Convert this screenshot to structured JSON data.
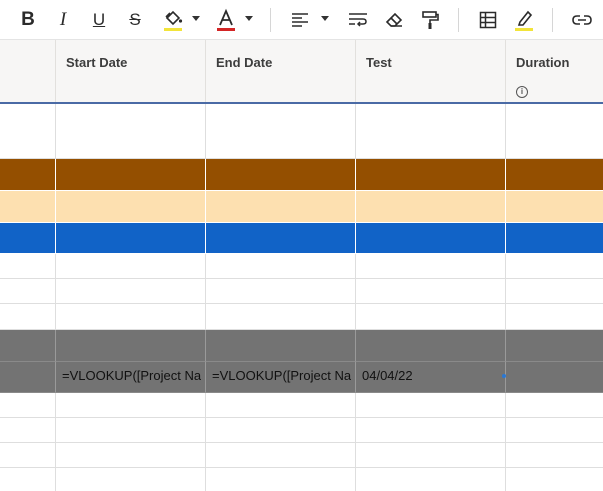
{
  "toolbar": {
    "items": [
      {
        "name": "bold-button",
        "glyph": "B"
      },
      {
        "name": "italic-button",
        "glyph": "I"
      },
      {
        "name": "underline-button",
        "glyph": "U"
      },
      {
        "name": "strikethrough-button",
        "glyph": "S"
      },
      {
        "name": "fill-color-button",
        "swatch": "#f2e43a"
      },
      {
        "name": "text-color-button",
        "glyph": "A",
        "swatch": "#d32525"
      },
      {
        "name": "align-button"
      },
      {
        "name": "wrap-text-button"
      },
      {
        "name": "clear-format-button"
      },
      {
        "name": "format-painter-button"
      },
      {
        "name": "table-button"
      },
      {
        "name": "highlight-button",
        "swatch": "#f2e43a"
      },
      {
        "name": "link-button"
      }
    ]
  },
  "columns": [
    {
      "label": ""
    },
    {
      "label": "Start Date"
    },
    {
      "label": "End Date"
    },
    {
      "label": "Test"
    },
    {
      "label": "Duration",
      "info_icon": "info-icon"
    }
  ],
  "rows": [
    {
      "style": "white",
      "fill": "#ffffff",
      "cells": [
        "",
        "",
        "",
        "",
        ""
      ]
    },
    {
      "style": "dark",
      "fill": "#944f00",
      "cells": [
        "",
        "",
        "",
        "",
        ""
      ]
    },
    {
      "style": "light",
      "fill": "#fde0b0",
      "cells": [
        "",
        "",
        "",
        "",
        ""
      ]
    },
    {
      "style": "dark",
      "fill": "#1163c7",
      "cells": [
        "",
        "",
        "",
        "",
        ""
      ]
    },
    {
      "style": "white",
      "fill": "#ffffff",
      "cells": [
        "",
        "",
        "",
        "",
        ""
      ]
    },
    {
      "style": "white",
      "fill": "#ffffff",
      "cells": [
        "",
        "",
        "",
        "",
        ""
      ]
    },
    {
      "style": "white",
      "fill": "#ffffff",
      "cells": [
        "",
        "",
        "",
        "",
        ""
      ]
    },
    {
      "style": "gray",
      "fill": "#737373",
      "cells": [
        "",
        "",
        "",
        "",
        ""
      ]
    },
    {
      "style": "gray",
      "fill": "#737373",
      "cells": [
        "",
        "=VLOOKUP([Project Name]",
        "=VLOOKUP([Project Name]",
        "04/04/22",
        ""
      ]
    },
    {
      "style": "white",
      "fill": "#ffffff",
      "cells": [
        "",
        "",
        "",
        "",
        ""
      ]
    },
    {
      "style": "white",
      "fill": "#ffffff",
      "cells": [
        "",
        "",
        "",
        "",
        ""
      ]
    },
    {
      "style": "white",
      "fill": "#ffffff",
      "cells": [
        "",
        "",
        "",
        "",
        ""
      ]
    },
    {
      "style": "white",
      "fill": "#ffffff",
      "cells": [
        "",
        "",
        "",
        "",
        ""
      ]
    }
  ]
}
